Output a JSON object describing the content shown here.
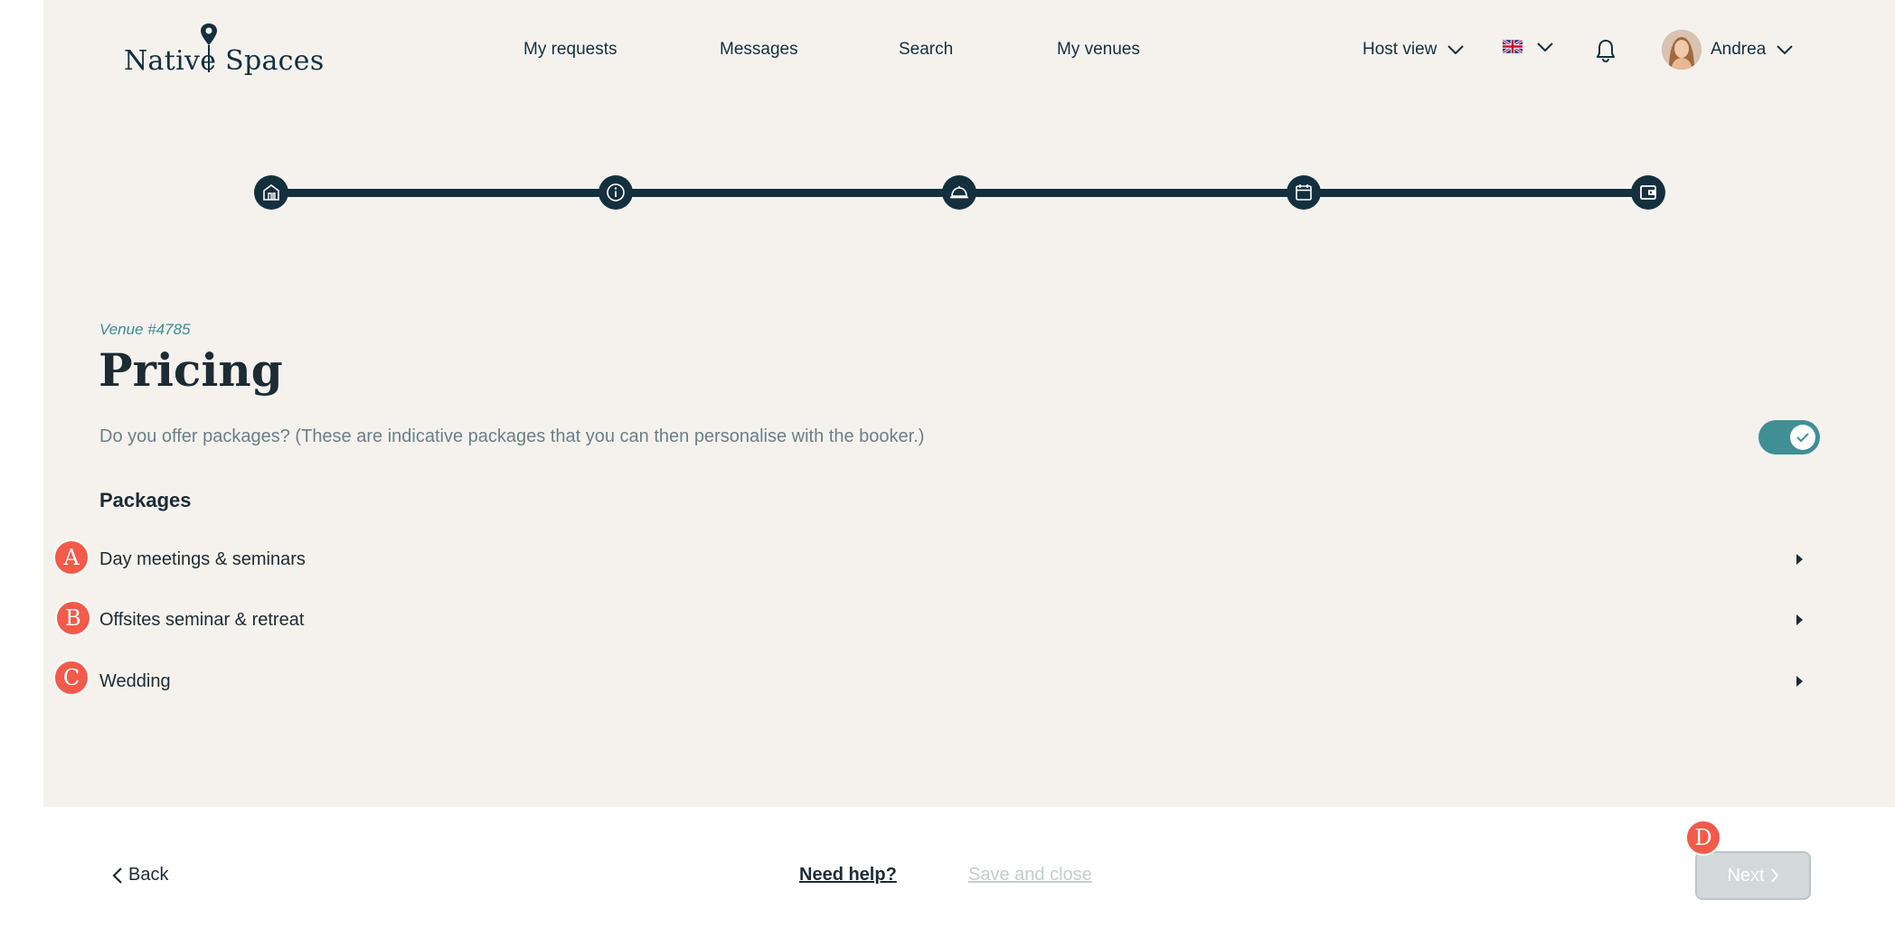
{
  "brand": {
    "logo_text": "Native Spaces",
    "color": "#13303f"
  },
  "nav": {
    "items": [
      {
        "label": "My requests"
      },
      {
        "label": "Messages"
      },
      {
        "label": "Search"
      },
      {
        "label": "My venues"
      }
    ],
    "host_view_label": "Host view",
    "language": "en-GB",
    "user_name": "Andrea"
  },
  "stepper": {
    "steps": [
      {
        "icon": "house-icon",
        "state": "done"
      },
      {
        "icon": "info-icon",
        "state": "done"
      },
      {
        "icon": "cloche-icon",
        "state": "done"
      },
      {
        "icon": "calendar-icon",
        "state": "done"
      },
      {
        "icon": "wallet-icon",
        "state": "current"
      }
    ]
  },
  "content": {
    "venue_id": "Venue #4785",
    "title": "Pricing",
    "question": "Do you offer packages? (These are indicative packages that you can then personalise with the booker.)",
    "offers_packages": true,
    "packages_heading": "Packages",
    "packages": [
      {
        "label": "Day meetings & seminars",
        "marker": "A"
      },
      {
        "label": "Offsites seminar & retreat",
        "marker": "B"
      },
      {
        "label": "Wedding",
        "marker": "C"
      }
    ]
  },
  "footer": {
    "back_label": "Back",
    "help_label": "Need help?",
    "save_label": "Save and close",
    "next_label": "Next",
    "next_marker": "D",
    "next_disabled": true
  },
  "colors": {
    "background": "#f5f2ee",
    "primary_dark": "#14303e",
    "accent_teal": "#3f8f94",
    "marker_red": "#f25a4a",
    "disabled_button": "#d3d9db"
  }
}
